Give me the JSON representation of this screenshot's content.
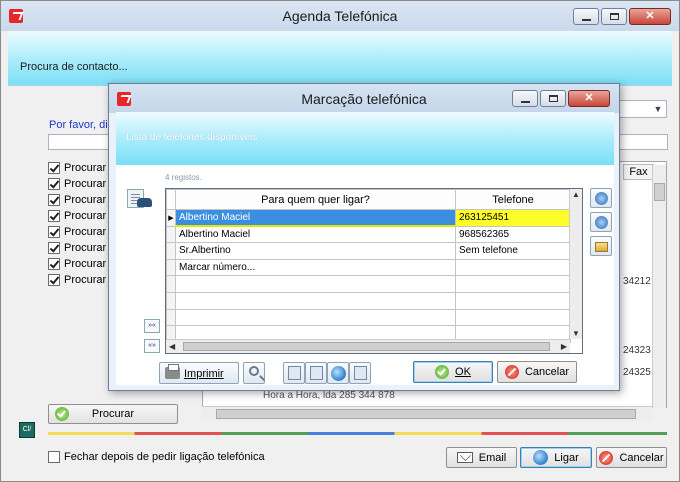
{
  "main": {
    "title": "Agenda Telefónica",
    "banner": "Procura de contacto...",
    "hint": "Por favor, digi",
    "checks": [
      {
        "label": "Procurar no",
        "checked": true
      },
      {
        "label": "Procurar no",
        "checked": true
      },
      {
        "label": "Procurar no",
        "checked": true
      },
      {
        "label": "Procurar no",
        "checked": true
      },
      {
        "label": "Procurar no",
        "checked": true
      },
      {
        "label": "Procurar no",
        "checked": true
      },
      {
        "label": "Procurar no",
        "checked": true
      },
      {
        "label": "Procurar no",
        "checked": true
      }
    ],
    "fax_header": "Fax",
    "bg_values": [
      "34212",
      "24323",
      "24325"
    ],
    "bg_row": "Hora a Hora, lda     285 344 878",
    "procurar_label": "Procurar",
    "small_tool_label": "Cl/",
    "close_after_label": "Fechar depois de pedir ligação telefónica",
    "email_label": "Email",
    "ligar_label": "Ligar",
    "cancelar_label": "Cancelar"
  },
  "dialog": {
    "title": "Marcação telefónica",
    "banner": "Lista de telefones disponíveis",
    "records": "4 registos.",
    "columns": [
      "Para quem quer ligar?",
      "Telefone"
    ],
    "rows": [
      {
        "name": "Albertino Maciel",
        "phone": "263125451",
        "selected": true
      },
      {
        "name": "Albertino Maciel",
        "phone": "968562365",
        "selected": false
      },
      {
        "name": "Sr.Albertino",
        "phone": "Sem telefone",
        "selected": false
      },
      {
        "name": "Marcar número...",
        "phone": "",
        "selected": false
      }
    ],
    "imprimir_label": "Imprimir",
    "ok_label": "OK",
    "cancelar_label": "Cancelar"
  },
  "colors": {
    "banner_cyan": "#7ddff6",
    "selection_blue": "#3b8fe1",
    "selection_yellow": "#fdfd2a",
    "link_blue": "#1f35c9"
  }
}
